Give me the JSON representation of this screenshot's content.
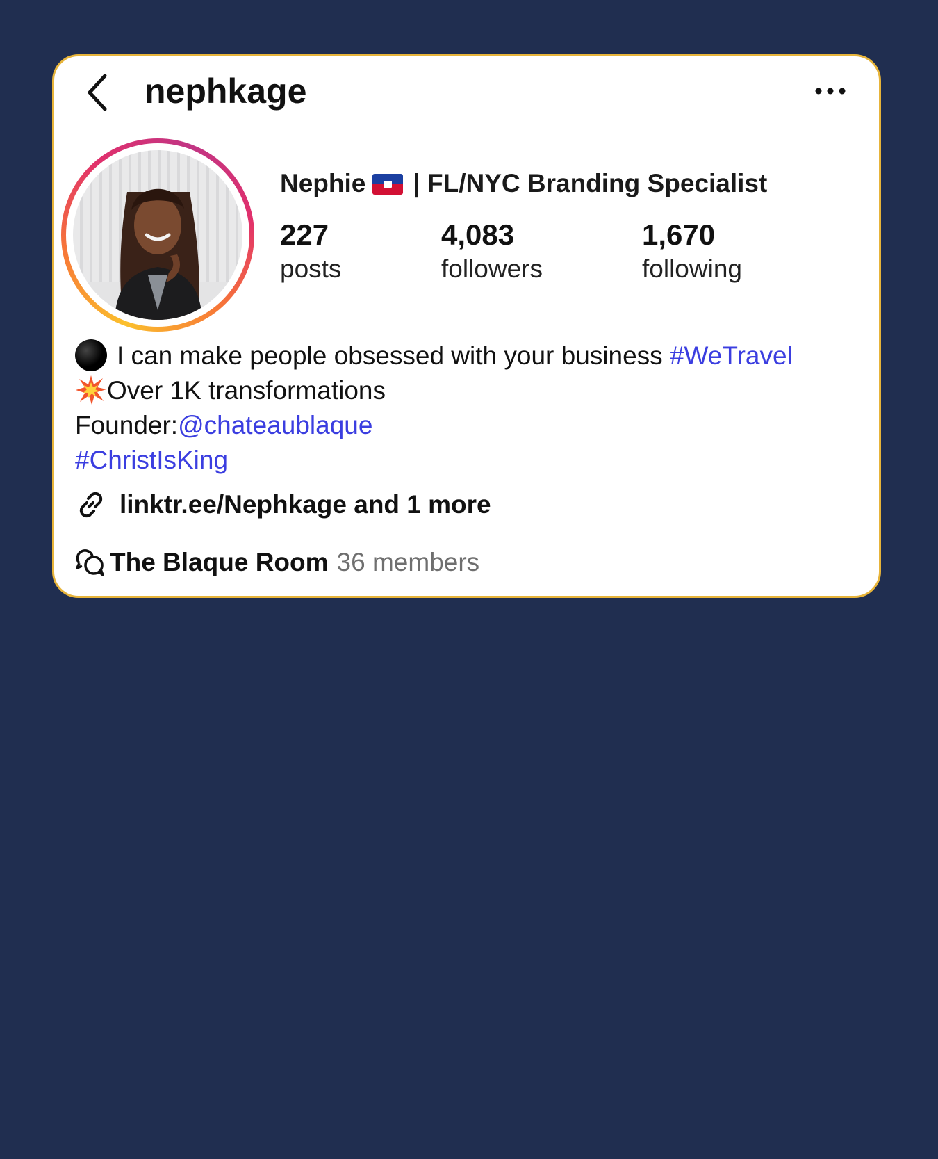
{
  "header": {
    "username": "nephkage"
  },
  "profile": {
    "name_before_flag": "Nephie",
    "name_after_flag": "| FL/NYC Branding Specialist",
    "stats": [
      {
        "value": "227",
        "label": "posts"
      },
      {
        "value": "4,083",
        "label": "followers"
      },
      {
        "value": "1,670",
        "label": "following"
      }
    ]
  },
  "bio": {
    "line1_text": "I can make people obsessed with your business ",
    "line1_tag": "#WeTravel",
    "line2_text": "Over 1K transformations",
    "line3_prefix": "Founder:",
    "line3_mention": "@chateaublaque",
    "line4_tag": "#ChristIsKing"
  },
  "link": {
    "text": "linktr.ee/Nephkage and 1 more"
  },
  "channel": {
    "name": "The Blaque Room",
    "members": "36 members"
  },
  "colors": {
    "background": "#202e50",
    "card_border": "#e7b43a",
    "link_blue": "#3b3ee0"
  },
  "icons": [
    "chevron-left-icon",
    "more-horizontal-icon",
    "link-icon",
    "chat-bubbles-icon",
    "black-circle-icon",
    "collision-icon",
    "haiti-flag-icon"
  ]
}
